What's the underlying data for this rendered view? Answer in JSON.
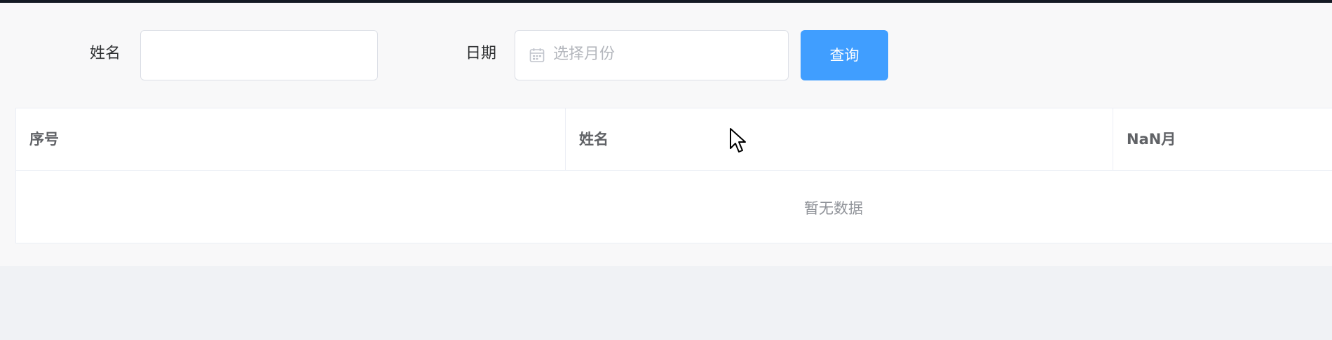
{
  "form": {
    "name_label": "姓名",
    "name_value": "",
    "date_label": "日期",
    "date_placeholder": "选择月份",
    "date_icon": "calendar-icon",
    "query_button": "查询"
  },
  "table": {
    "columns": [
      "序号",
      "姓名",
      "NaN月"
    ],
    "rows": [],
    "empty_text": "暂无数据"
  },
  "colors": {
    "primary": "#409eff",
    "background": "#f0f2f5",
    "panel": "#f8f8f9"
  }
}
